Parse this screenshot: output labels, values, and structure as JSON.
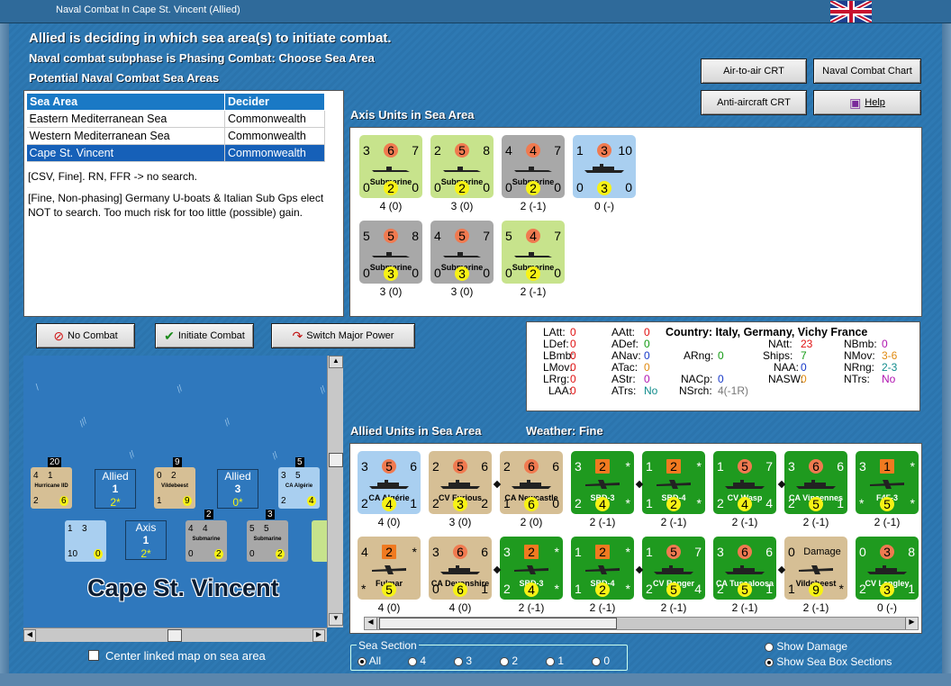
{
  "window": {
    "title": "Naval Combat In Cape St. Vincent (Allied)"
  },
  "header": {
    "line1": "Allied is deciding in which sea area(s) to initiate combat.",
    "line2": "Naval combat subphase is Phasing Combat: Choose Sea Area",
    "line3": "Potential Naval Combat Sea Areas"
  },
  "buttons": {
    "air_crt": "Air-to-air CRT",
    "naval_chart": "Naval Combat Chart",
    "aa_crt": "Anti-aircraft CRT",
    "help": "Help",
    "no_combat": "No Combat",
    "initiate": "Initiate Combat",
    "switch": "Switch Major Power"
  },
  "sea_table": {
    "headers": [
      "Sea Area",
      "Decider"
    ],
    "rows": [
      [
        "Eastern Mediterranean Sea",
        "Commonwealth"
      ],
      [
        "Western Mediterranean Sea",
        "Commonwealth"
      ],
      [
        "Cape St. Vincent",
        "Commonwealth"
      ]
    ]
  },
  "notes": {
    "n1": "[CSV, Fine].  RN, FFR -> no search.",
    "n2": "[Fine, Non-phasing]  Germany U-boats & Italian Sub Gps elect NOT to search.  Too much risk for too little (possible) gain."
  },
  "axis": {
    "label": "Axis Units in Sea Area",
    "units": [
      {
        "tl": "3",
        "tm": "6",
        "tr": "7",
        "nm": "Submarine",
        "bl": "0",
        "bm": "2",
        "br": "0",
        "cap": "4 (0)"
      },
      {
        "tl": "2",
        "tm": "5",
        "tr": "8",
        "nm": "Submarine",
        "bl": "0",
        "bm": "2",
        "br": "0",
        "cap": "3 (0)"
      },
      {
        "tl": "4",
        "tm": "4",
        "tr": "7",
        "nm": "Submarine",
        "bl": "0",
        "bm": "2",
        "br": "0",
        "cap": "2 (-1)"
      },
      {
        "tl": "1",
        "tm": "3",
        "tr": "10",
        "nm": "",
        "bl": "0",
        "bm": "3",
        "br": "0",
        "cap": "0 (-)"
      },
      {
        "tl": "5",
        "tm": "5",
        "tr": "8",
        "nm": "Submarine",
        "bl": "0",
        "bm": "3",
        "br": "0",
        "cap": "3 (0)"
      },
      {
        "tl": "4",
        "tm": "5",
        "tr": "7",
        "nm": "Submarine",
        "bl": "0",
        "bm": "3",
        "br": "0",
        "cap": "3 (0)"
      },
      {
        "tl": "5",
        "tm": "4",
        "tr": "7",
        "nm": "Submarine",
        "bl": "0",
        "bm": "2",
        "br": "0",
        "cap": "2 (-1)"
      }
    ]
  },
  "stats": {
    "country": "Country: Italy, Germany, Vichy France",
    "col1": [
      [
        "LAtt:",
        "0"
      ],
      [
        "LDef:",
        "0"
      ],
      [
        "LBmb:",
        "0"
      ],
      [
        "LMov:",
        "0"
      ],
      [
        "LRrg:",
        "0"
      ],
      [
        "LAA:",
        "0"
      ]
    ],
    "col2": [
      [
        "AAtt:",
        "0"
      ],
      [
        "ADef:",
        "0"
      ],
      [
        "ANav:",
        "0"
      ],
      [
        "ATac:",
        "0"
      ],
      [
        "AStr:",
        "0"
      ],
      [
        "ATrs:",
        "No"
      ]
    ],
    "arng": [
      "ARng:",
      "0"
    ],
    "nacp": [
      "NACp:",
      "0"
    ],
    "nsrch": [
      "NSrch:",
      "4(-1R)"
    ],
    "col4": [
      [
        "NAtt:",
        "23"
      ],
      [
        "Ships:",
        "7"
      ],
      [
        "NAA:",
        "0"
      ],
      [
        "NASW:",
        "0"
      ]
    ],
    "col5": [
      [
        "NBmb:",
        "0"
      ],
      [
        "NMov:",
        "3-6"
      ],
      [
        "NRng:",
        "2-3"
      ],
      [
        "NTrs:",
        "No"
      ]
    ]
  },
  "map": {
    "boxes": [
      {
        "t": "Allied",
        "n": "1",
        "s": "2*"
      },
      {
        "t": "Allied",
        "n": "3",
        "s": "0*"
      },
      {
        "t": "Axis",
        "n": "1",
        "s": "2*"
      }
    ],
    "stacks": [
      "20",
      "9",
      "5",
      "2",
      "3"
    ],
    "counters": [
      {
        "nm": "Hurricane IID",
        "a": "4",
        "b": "1",
        "c": "2",
        "d": "6"
      },
      {
        "nm": "Vildebeest",
        "a": "0",
        "b": "2",
        "c": "1",
        "d": "9"
      },
      {
        "nm": "CA Algérie",
        "a": "3",
        "b": "5",
        "c": "2",
        "d": "4"
      },
      {
        "nm": "",
        "a": "1",
        "b": "3",
        "c": "10",
        "d": "0"
      },
      {
        "nm": "Submarine",
        "a": "4",
        "b": "4",
        "c": "0",
        "d": "2"
      },
      {
        "nm": "Submarine",
        "a": "5",
        "b": "5",
        "c": "0",
        "d": "2"
      }
    ],
    "sea_name": "Cape St. Vincent",
    "center_label": "Center linked map on sea area"
  },
  "allied": {
    "label": "Allied Units in Sea Area",
    "weather": "Weather:  Fine",
    "units": [
      {
        "tl": "3",
        "tm": "5",
        "tr": "6",
        "nm": "CA Algérie",
        "bl": "2",
        "bm": "4",
        "br": "1",
        "cap": "4 (0)",
        "bg": "#a9cff0"
      },
      {
        "tl": "2",
        "tm": "5",
        "tr": "6",
        "nm": "CV Furious",
        "bl": "2",
        "bm": "3",
        "br": "2",
        "cap": "3 (0)",
        "bg": "#d6bf95"
      },
      {
        "tl": "2",
        "tm": "6",
        "tr": "6",
        "nm": "CA Newcastle",
        "bl": "1",
        "bm": "6",
        "br": "0",
        "cap": "2 (0)",
        "bg": "#d6bf95"
      },
      {
        "tl": "3",
        "tm": "2",
        "tr": "*",
        "nm": "SBD-3",
        "bl": "2",
        "bm": "4",
        "br": "*",
        "cap": "2 (-1)",
        "bg": "#1f9a1f"
      },
      {
        "tl": "1",
        "tm": "2",
        "tr": "*",
        "nm": "SBD-4",
        "bl": "1",
        "bm": "2",
        "br": "*",
        "cap": "2 (-1)",
        "bg": "#1f9a1f"
      },
      {
        "tl": "1",
        "tm": "5",
        "tr": "7",
        "nm": "CV Wasp",
        "bl": "2",
        "bm": "4",
        "br": "4",
        "cap": "2 (-1)",
        "bg": "#1f9a1f"
      },
      {
        "tl": "3",
        "tm": "6",
        "tr": "6",
        "nm": "CA Vincennes",
        "bl": "2",
        "bm": "5",
        "br": "1",
        "cap": "2 (-1)",
        "bg": "#1f9a1f"
      },
      {
        "tl": "3",
        "tm": "1",
        "tr": "*",
        "nm": "F4F-3",
        "bl": "*",
        "bm": "5",
        "br": "*",
        "cap": "2 (-1)",
        "bg": "#1f9a1f"
      },
      {
        "tl": "4",
        "tm": "2",
        "tr": "*",
        "nm": "Fulmar",
        "bl": "*",
        "bm": "5",
        "br": "",
        "cap": "4 (0)",
        "bg": "#d6bf95"
      },
      {
        "tl": "3",
        "tm": "6",
        "tr": "6",
        "nm": "CA Devonshire",
        "bl": "0",
        "bm": "6",
        "br": "1",
        "cap": "4 (0)",
        "bg": "#d6bf95"
      },
      {
        "tl": "3",
        "tm": "2",
        "tr": "*",
        "nm": "SBD-3",
        "bl": "2",
        "bm": "4",
        "br": "*",
        "cap": "2 (-1)",
        "bg": "#1f9a1f"
      },
      {
        "tl": "1",
        "tm": "2",
        "tr": "*",
        "nm": "SBD-4",
        "bl": "1",
        "bm": "2",
        "br": "*",
        "cap": "2 (-1)",
        "bg": "#1f9a1f"
      },
      {
        "tl": "1",
        "tm": "5",
        "tr": "7",
        "nm": "CV Ranger",
        "bl": "2",
        "bm": "5",
        "br": "4",
        "cap": "2 (-1)",
        "bg": "#1f9a1f"
      },
      {
        "tl": "3",
        "tm": "6",
        "tr": "6",
        "nm": "CA Tuscaloosa",
        "bl": "2",
        "bm": "5",
        "br": "1",
        "cap": "2 (-1)",
        "bg": "#1f9a1f"
      },
      {
        "tl": "0",
        "tm": "Damage",
        "tr": "",
        "nm": "Vildebeest",
        "bl": "1",
        "bm": "9",
        "br": "*",
        "cap": "2 (-1)",
        "bg": "#d6bf95"
      },
      {
        "tl": "0",
        "tm": "3",
        "tr": "8",
        "nm": "CV Langley",
        "bl": "2",
        "bm": "3",
        "br": "1",
        "cap": "0 (-)",
        "bg": "#1f9a1f"
      }
    ]
  },
  "sea_section": {
    "label": "Sea Section",
    "options": [
      "All",
      "4",
      "3",
      "2",
      "1",
      "0"
    ],
    "selected": "All"
  },
  "display": {
    "show_damage": "Show Damage",
    "show_sections": "Show Sea Box Sections"
  }
}
